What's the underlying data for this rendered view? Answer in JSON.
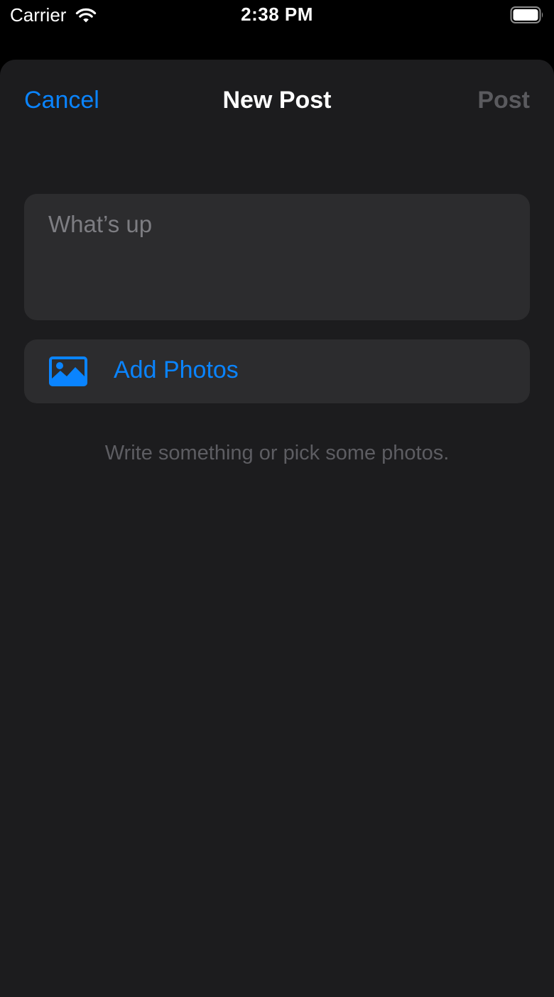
{
  "status_bar": {
    "carrier": "Carrier",
    "time": "2:38 PM",
    "wifi_icon": "wifi-icon",
    "battery_icon": "battery-full-icon"
  },
  "nav": {
    "cancel_label": "Cancel",
    "title": "New Post",
    "post_label": "Post",
    "post_enabled": false
  },
  "compose": {
    "value": "",
    "placeholder": "What’s up"
  },
  "photos": {
    "icon": "photo-icon",
    "label": "Add Photos"
  },
  "hint": "Write something or pick some photos.",
  "colors": {
    "accent": "#0a84ff",
    "sheet_background": "#1c1c1e",
    "card_background": "#2c2c2e",
    "disabled_text": "#5a5a5e"
  }
}
